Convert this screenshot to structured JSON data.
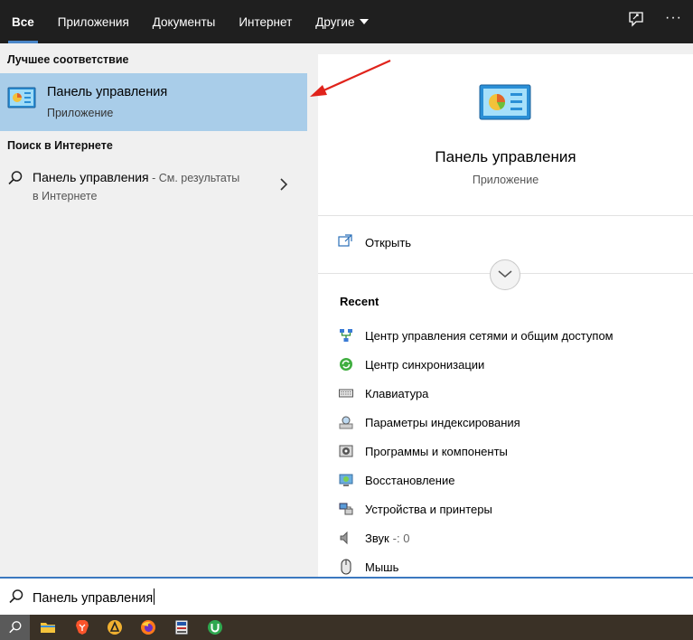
{
  "tabs": [
    {
      "label": "Все",
      "active": true
    },
    {
      "label": "Приложения",
      "active": false
    },
    {
      "label": "Документы",
      "active": false
    },
    {
      "label": "Интернет",
      "active": false
    },
    {
      "label": "Другие",
      "active": false
    }
  ],
  "top_icons": {
    "feedback": "feedback-icon",
    "more": "···"
  },
  "left": {
    "best_match_heading": "Лучшее соответствие",
    "best_match": {
      "name": "Панель управления",
      "kind": "Приложение",
      "icon": "control-panel-icon"
    },
    "web_heading": "Поиск в Интернете",
    "web_result": {
      "query": "Панель управления",
      "suffix": " - См. результаты",
      "line2": "в Интернете"
    }
  },
  "detail": {
    "title": "Панель управления",
    "subtitle": "Приложение",
    "open_label": "Открыть",
    "recent_heading": "Recent",
    "recent": [
      {
        "label": "Центр управления сетями и общим доступом",
        "sub": "",
        "icon": "network-center-icon"
      },
      {
        "label": "Центр синхронизации",
        "sub": "",
        "icon": "sync-center-icon"
      },
      {
        "label": "Клавиатура",
        "sub": "",
        "icon": "keyboard-icon"
      },
      {
        "label": "Параметры индексирования",
        "sub": "",
        "icon": "indexing-icon"
      },
      {
        "label": "Программы и компоненты",
        "sub": "",
        "icon": "programs-icon"
      },
      {
        "label": "Восстановление",
        "sub": "",
        "icon": "recovery-icon"
      },
      {
        "label": "Устройства и принтеры",
        "sub": "",
        "icon": "devices-printers-icon"
      },
      {
        "label": "Звук",
        "sub": "-: 0",
        "icon": "sound-icon"
      },
      {
        "label": "Мышь",
        "sub": "",
        "icon": "mouse-icon"
      }
    ]
  },
  "search": {
    "value": "Панель управления"
  },
  "colors": {
    "topbar": "#1f1f1f",
    "selection": "#a9cde9",
    "accent": "#3b78c0",
    "arrow": "#e0231b"
  },
  "taskbar": [
    "search-icon",
    "file-explorer-icon",
    "brave-icon",
    "aimp-icon",
    "firefox-icon",
    "app-icon",
    "utorrent-icon"
  ]
}
